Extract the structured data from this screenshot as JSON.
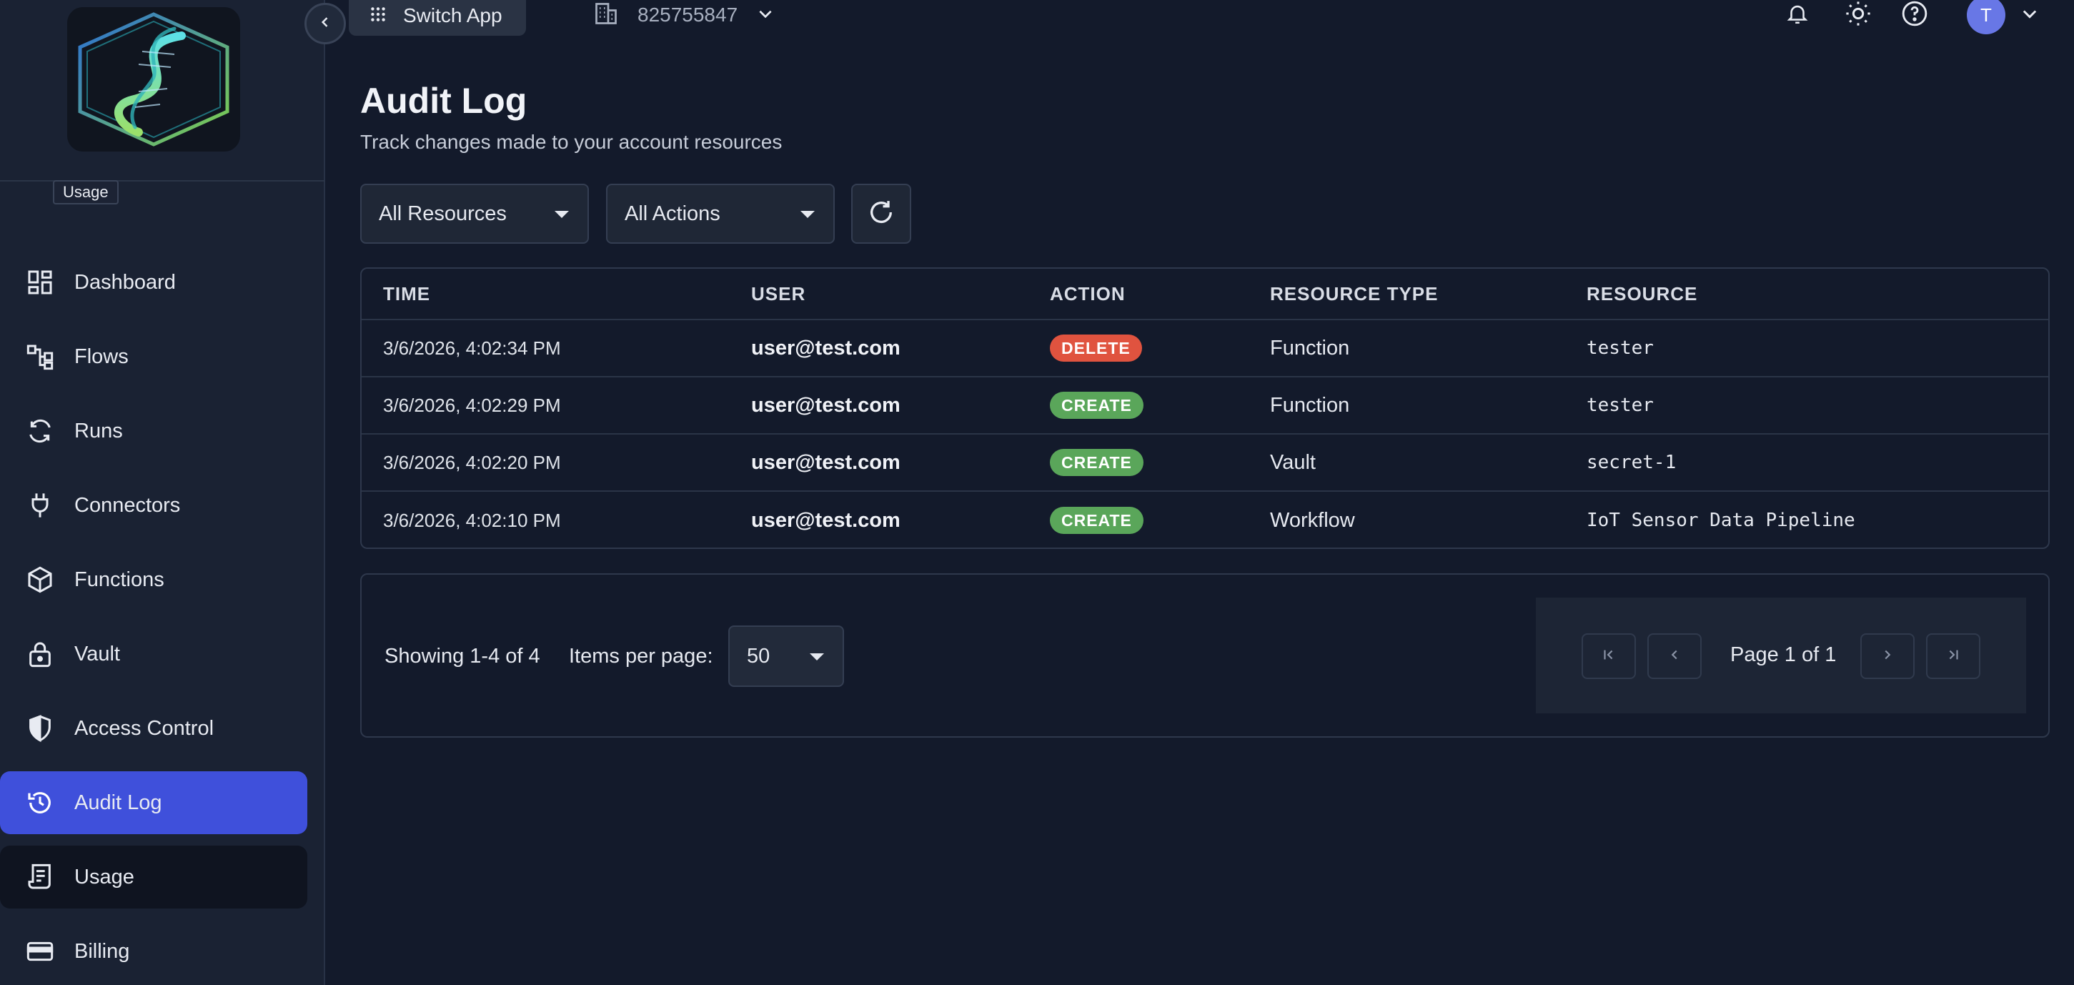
{
  "sidebar": {
    "tooltip": "Usage",
    "items": [
      {
        "label": "Dashboard",
        "icon": "dashboard-icon"
      },
      {
        "label": "Flows",
        "icon": "flows-icon"
      },
      {
        "label": "Runs",
        "icon": "runs-icon"
      },
      {
        "label": "Connectors",
        "icon": "plug-icon"
      },
      {
        "label": "Functions",
        "icon": "cube-icon"
      },
      {
        "label": "Vault",
        "icon": "lock-icon"
      },
      {
        "label": "Access Control",
        "icon": "shield-icon"
      },
      {
        "label": "Audit Log",
        "icon": "history-icon",
        "active": true
      },
      {
        "label": "Usage",
        "icon": "receipt-icon",
        "hover": true
      },
      {
        "label": "Billing",
        "icon": "credit-card-icon"
      }
    ]
  },
  "topbar": {
    "switch_app_label": "Switch App",
    "org_id": "825755847",
    "avatar_initial": "T"
  },
  "page": {
    "title": "Audit Log",
    "subtitle": "Track changes made to your account resources"
  },
  "filters": {
    "resources_value": "All Resources",
    "actions_value": "All Actions"
  },
  "table": {
    "columns": [
      "TIME",
      "USER",
      "ACTION",
      "RESOURCE TYPE",
      "RESOURCE"
    ],
    "rows": [
      {
        "time": "3/6/2026, 4:02:34 PM",
        "user": "user@test.com",
        "action": "DELETE",
        "resource_type": "Function",
        "resource": "tester"
      },
      {
        "time": "3/6/2026, 4:02:29 PM",
        "user": "user@test.com",
        "action": "CREATE",
        "resource_type": "Function",
        "resource": "tester"
      },
      {
        "time": "3/6/2026, 4:02:20 PM",
        "user": "user@test.com",
        "action": "CREATE",
        "resource_type": "Vault",
        "resource": "secret-1"
      },
      {
        "time": "3/6/2026, 4:02:10 PM",
        "user": "user@test.com",
        "action": "CREATE",
        "resource_type": "Workflow",
        "resource": "IoT Sensor Data Pipeline"
      }
    ]
  },
  "pagination": {
    "showing": "Showing 1-4 of 4",
    "items_per_page_label": "Items per page:",
    "items_per_page_value": "50",
    "page_indicator": "Page 1 of 1"
  },
  "colors": {
    "accent": "#3f50db",
    "delete_badge": "#e0533f",
    "create_badge": "#5aa65a",
    "background": "#131a2b",
    "sidebar": "#1a2233"
  }
}
